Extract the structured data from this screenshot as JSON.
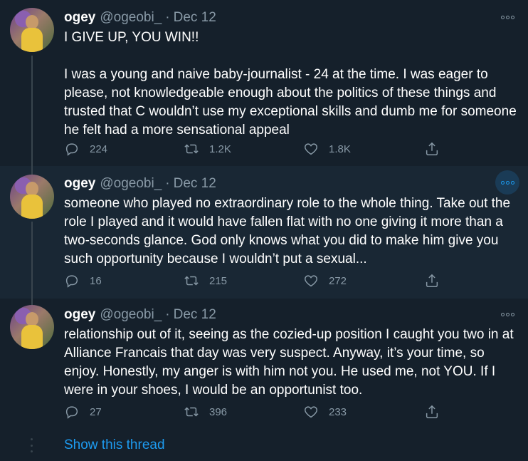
{
  "tweets": [
    {
      "name": "ogey",
      "handle": "@ogeobi_",
      "dot": "·",
      "date": "Dec 12",
      "paragraphs": [
        "I GIVE UP, YOU WIN!!",
        "I was a young and naive baby-journalist - 24 at the time. I was eager to please, not knowledgeable enough about the politics of these things and trusted that C wouldn’t use my exceptional skills and dumb me for someone he felt had a more sensational appeal"
      ],
      "replies": "224",
      "retweets": "1.2K",
      "likes": "1.8K"
    },
    {
      "name": "ogey",
      "handle": "@ogeobi_",
      "dot": "·",
      "date": "Dec 12",
      "paragraphs": [
        "someone who played no extraordinary role to the whole thing. Take out the role I played and it would have fallen flat with no one giving it more than a two-seconds glance. God only knows what you did to make him give you such opportunity because I wouldn’t put a sexual..."
      ],
      "replies": "16",
      "retweets": "215",
      "likes": "272"
    },
    {
      "name": "ogey",
      "handle": "@ogeobi_",
      "dot": "·",
      "date": "Dec 12",
      "paragraphs": [
        "relationship out of it, seeing as the cozied-up position I caught you two in at Alliance Francais that day was very suspect. Anyway, it’s your time, so enjoy. Honestly, my anger is with him not you. He used me, not YOU. If I were in your shoes, I would be an opportunist too."
      ],
      "replies": "27",
      "retweets": "396",
      "likes": "233"
    }
  ],
  "show_thread": "Show this thread",
  "colors": {
    "background": "#15202b",
    "hover_background": "#192734",
    "muted": "#8899a6",
    "accent": "#1d9bf0",
    "thread_line": "#38444d"
  },
  "icons": [
    "reply-icon",
    "retweet-icon",
    "like-icon",
    "share-icon",
    "more-icon"
  ]
}
